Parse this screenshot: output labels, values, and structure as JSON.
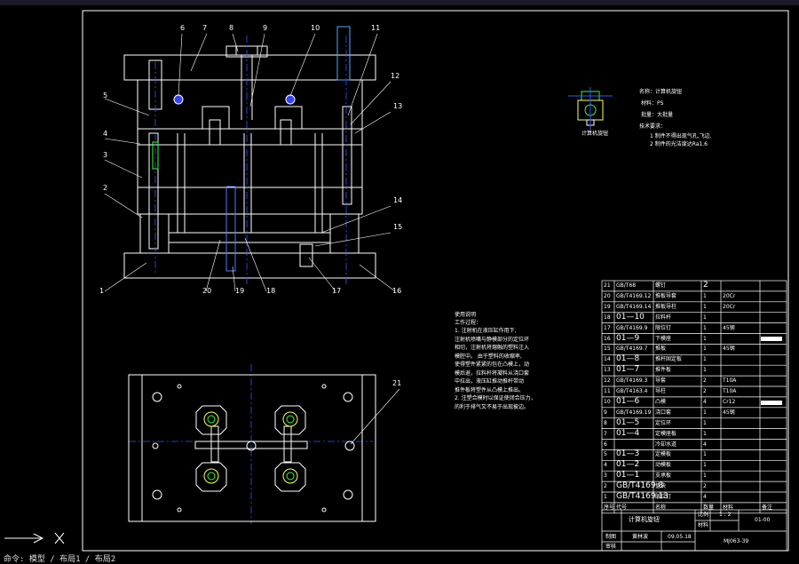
{
  "part_labels": [
    "1",
    "2",
    "3",
    "4",
    "5",
    "6",
    "7",
    "8",
    "9",
    "10",
    "11",
    "12",
    "13",
    "14",
    "15",
    "16",
    "17",
    "18",
    "19",
    "20",
    "21"
  ],
  "part_info": {
    "caption": "计算机旋钮",
    "name": "名称：计算机旋钮",
    "material": "材料：PS",
    "shrink": "批量：大批量",
    "tech_title": "技术要求：",
    "req1": "1 制件不得出现气孔,飞边.",
    "req2": "2 制件的光洁度达Ra1.6"
  },
  "usage_note": {
    "title": "使用说明",
    "subtitle": "工作过程：",
    "lines": [
      "1. 注射机在液压缸作用下,",
      "注射机喷嘴与静模部分的定位环",
      "相切，注射机将熔融的塑料注入",
      "模腔中。  由于塑料的收缩率,",
      "使得塑件紧紧的包在凸模上，动",
      "模后退，拉料杆将凝料从浇口套",
      "中拉出，液压缸推动推杆带动",
      "推件板将塑件从凸模上推出。",
      "2. 注塑合模时以保证使闭合压力，",
      "的利于排气又不易于出现披边。"
    ]
  },
  "bom_rows": [
    {
      "no": "21",
      "code": "GB/T68",
      "name": "螺钉",
      "qty": "2",
      "mat": "",
      "note": ""
    },
    {
      "no": "20",
      "code": "GB/T4169.12",
      "name": "推板导套",
      "qty": "1",
      "mat": "20Cr",
      "note": ""
    },
    {
      "no": "19",
      "code": "GB/T4169.14",
      "name": "推板导柱",
      "qty": "1",
      "mat": "20Cr",
      "note": ""
    },
    {
      "no": "18",
      "code": "01—10",
      "name": "拉料杆",
      "qty": "1",
      "mat": "",
      "note": ""
    },
    {
      "no": "17",
      "code": "GB/T4169.9",
      "name": "限位钉",
      "qty": "1",
      "mat": "45钢",
      "note": ""
    },
    {
      "no": "16",
      "code": "01—9",
      "name": "下模座",
      "qty": "1",
      "mat": "",
      "note": ""
    },
    {
      "no": "15",
      "code": "GB/T4169.7",
      "name": "推板",
      "qty": "1",
      "mat": "45钢",
      "note": ""
    },
    {
      "no": "14",
      "code": "01—8",
      "name": "推杆固定板",
      "qty": "1",
      "mat": "",
      "note": ""
    },
    {
      "no": "13",
      "code": "01—7",
      "name": "推件板",
      "qty": "1",
      "mat": "",
      "note": ""
    },
    {
      "no": "12",
      "code": "GB/T4169.3",
      "name": "导套",
      "qty": "2",
      "mat": "T10A",
      "note": ""
    },
    {
      "no": "11",
      "code": "GB/T4163.4",
      "name": "导柱",
      "qty": "2",
      "mat": "T10A",
      "note": ""
    },
    {
      "no": "10",
      "code": "01—6",
      "name": "凸模",
      "qty": "4",
      "mat": "Cr12",
      "note": ""
    },
    {
      "no": "9",
      "code": "GB/T4169.19",
      "name": "浇口套",
      "qty": "1",
      "mat": "45钢",
      "note": ""
    },
    {
      "no": "8",
      "code": "01—5",
      "name": "定位环",
      "qty": "1",
      "mat": "",
      "note": ""
    },
    {
      "no": "7",
      "code": "01—4",
      "name": "定模座板",
      "qty": "1",
      "mat": "",
      "note": ""
    },
    {
      "no": "6",
      "code": "",
      "name": "冷却水道",
      "qty": "4",
      "mat": "",
      "note": ""
    },
    {
      "no": "5",
      "code": "01—3",
      "name": "定模板",
      "qty": "1",
      "mat": "",
      "note": ""
    },
    {
      "no": "4",
      "code": "01—2",
      "name": "动模板",
      "qty": "1",
      "mat": "",
      "note": ""
    },
    {
      "no": "3",
      "code": "01—1",
      "name": "支承板",
      "qty": "1",
      "mat": "",
      "note": ""
    },
    {
      "no": "2",
      "code": "GB/T4169.8",
      "name": "垫块",
      "qty": "2",
      "mat": "",
      "note": ""
    },
    {
      "no": "1",
      "code": "GB/T4169.13",
      "name": "限位钉",
      "qty": "4",
      "mat": "",
      "note": ""
    }
  ],
  "bom_header": {
    "no": "序号",
    "code": "代号",
    "name": "名称",
    "qty": "数量",
    "mat": "材料",
    "note": "备注"
  },
  "title_block": {
    "title": "计算机旋钮",
    "scale_label": "比例",
    "scale": "1 : 2",
    "material_label": "材料",
    "drawing_no": "01-00",
    "drawn_label": "制图",
    "drawn_by": "黄林波",
    "date": "09.05.18",
    "checked_label": "审核",
    "code": "MJ063-39"
  },
  "command_line": "命令: 模型 / 布局1 / 布局2"
}
